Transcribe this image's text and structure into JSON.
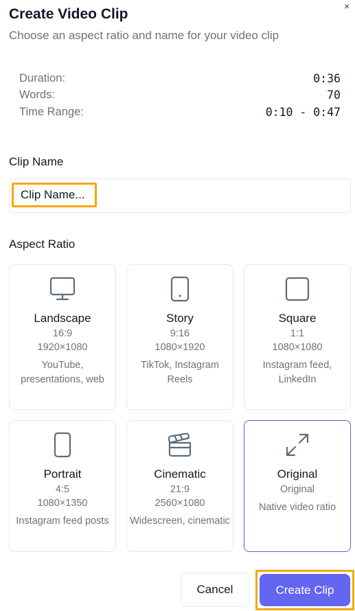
{
  "dialog": {
    "title": "Create Video Clip",
    "subtitle": "Choose an aspect ratio and name for your video clip",
    "close_symbol": "×"
  },
  "stats": [
    {
      "label": "Duration:",
      "value": "0:36"
    },
    {
      "label": "Words:",
      "value": "70"
    },
    {
      "label": "Time Range:",
      "value": "0:10 - 0:47"
    }
  ],
  "clip_name": {
    "label": "Clip Name",
    "placeholder": "Clip Name...",
    "value": ""
  },
  "aspect_ratio": {
    "label": "Aspect Ratio",
    "selected": "Original",
    "options": [
      {
        "name": "Landscape",
        "ratio": "16:9",
        "resolution": "1920×1080",
        "description": "YouTube, presentations, web",
        "icon": "monitor-icon"
      },
      {
        "name": "Story",
        "ratio": "9:16",
        "resolution": "1080×1920",
        "description": "TikTok, Instagram Reels",
        "icon": "phone-icon"
      },
      {
        "name": "Square",
        "ratio": "1:1",
        "resolution": "1080×1080",
        "description": "Instagram feed, LinkedIn",
        "icon": "square-icon"
      },
      {
        "name": "Portrait",
        "ratio": "4:5",
        "resolution": "1080×1350",
        "description": "Instagram feed posts",
        "icon": "portrait-icon"
      },
      {
        "name": "Cinematic",
        "ratio": "21:9",
        "resolution": "2560×1080",
        "description": "Widescreen, cinematic",
        "icon": "clapperboard-icon"
      },
      {
        "name": "Original",
        "ratio": "Original",
        "resolution": "",
        "description": "Native video ratio",
        "icon": "expand-icon"
      }
    ]
  },
  "buttons": {
    "cancel": "Cancel",
    "create": "Create Clip"
  },
  "colors": {
    "accent": "#6366f1",
    "highlight": "#f6a800",
    "selected_border": "#5b5fcf"
  }
}
